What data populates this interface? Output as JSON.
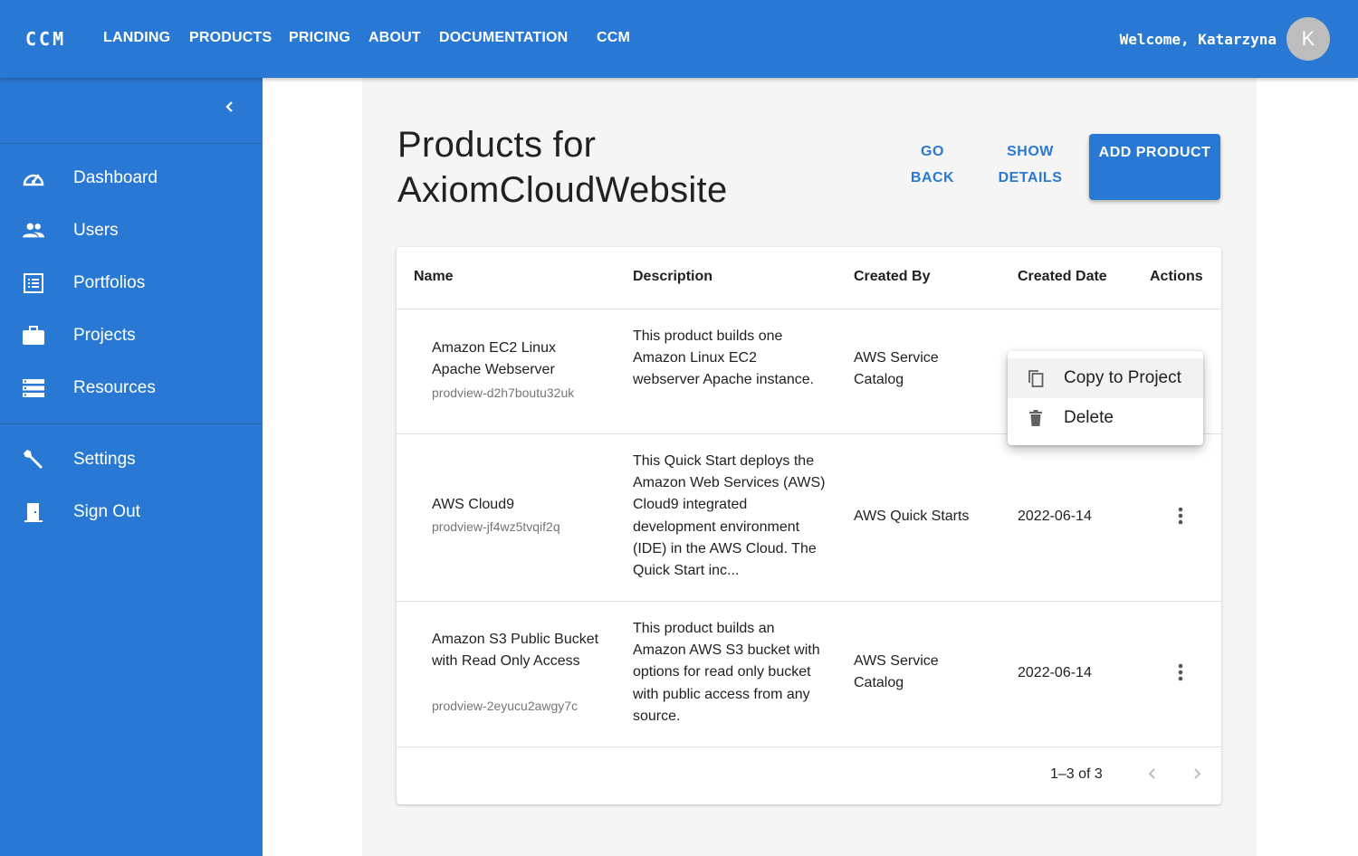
{
  "appbar": {
    "brand": "CCM",
    "nav": [
      "LANDING",
      "PRODUCTS",
      "PRICING",
      "ABOUT",
      "DOCUMENTATION",
      "CCM"
    ],
    "welcome": "Welcome, Katarzyna",
    "avatar_initial": "K",
    "color": "#2979d4"
  },
  "sidebar": {
    "collapse_icon": "chevron-left-icon",
    "items": [
      {
        "label": "Dashboard",
        "icon": "speedometer-icon"
      },
      {
        "label": "Users",
        "icon": "people-icon"
      },
      {
        "label": "Portfolios",
        "icon": "list-icon"
      },
      {
        "label": "Projects",
        "icon": "briefcase-icon"
      },
      {
        "label": "Resources",
        "icon": "storage-icon"
      },
      {
        "label": "Settings",
        "icon": "wrench-icon"
      },
      {
        "label": "Sign Out",
        "icon": "exit-door-icon"
      }
    ]
  },
  "page": {
    "title": "Products for AxiomCloudWebsite",
    "go_back": "GO BACK",
    "show_details": "SHOW DETAILS",
    "add_product": "ADD PRODUCT"
  },
  "table": {
    "headers": [
      "Name",
      "Description",
      "Created By",
      "Created Date",
      "Actions"
    ],
    "rows": [
      {
        "name": "Amazon EC2 Linux Apache Webserver",
        "id": "prodview-d2h7boutu32uk",
        "description": "This product builds one Amazon Linux EC2 webserver Apache instance.",
        "created_by": "AWS Service Catalog",
        "created_date": ""
      },
      {
        "name": "AWS Cloud9",
        "id": "prodview-jf4wz5tvqif2q",
        "description": "This Quick Start deploys the Amazon Web Services (AWS) Cloud9 integrated development environment (IDE) in the AWS Cloud. The Quick Start inc...",
        "created_by": "AWS Quick Starts",
        "created_date": "2022-06-14"
      },
      {
        "name": "Amazon S3 Public Bucket with Read Only Access",
        "id": "prodview-2eyucu2awgy7c",
        "description": "This product builds an Amazon AWS S3 bucket with options for read only bucket with public access from any source.",
        "created_by": "AWS Service Catalog",
        "created_date": "2022-06-14"
      }
    ],
    "pagination": "1–3 of 3"
  },
  "menu": {
    "items": [
      {
        "label": "Copy to Project",
        "icon": "copy-icon"
      },
      {
        "label": "Delete",
        "icon": "trash-icon"
      }
    ]
  }
}
